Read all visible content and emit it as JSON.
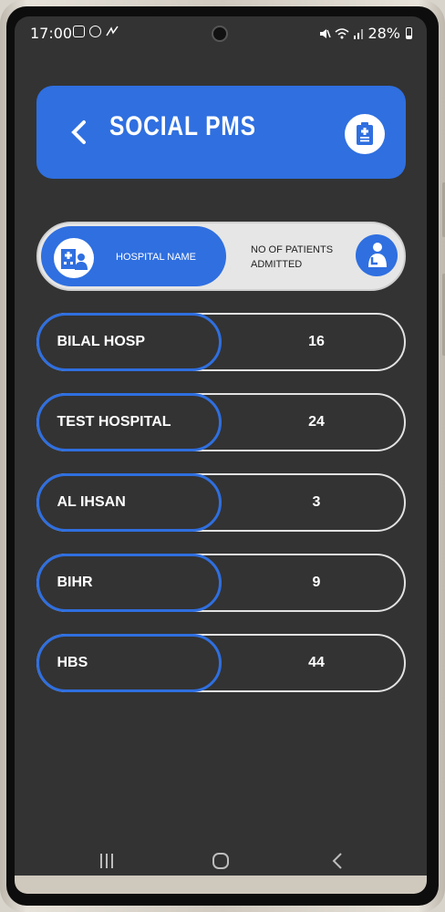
{
  "status_bar": {
    "time": "17:00",
    "battery": "28%"
  },
  "header": {
    "title": "SOCIAL PMS",
    "back_icon": "chevron-left-icon",
    "action_icon": "clipboard-medical-icon"
  },
  "table_header": {
    "hospital_label": "HOSPITAL NAME",
    "patients_label_line1": "NO OF PATIENTS",
    "patients_label_line2": "ADMITTED"
  },
  "rows": [
    {
      "name": "BILAL HOSP",
      "count": "16"
    },
    {
      "name": "TEST HOSPITAL",
      "count": "24"
    },
    {
      "name": "AL IHSAN",
      "count": "3"
    },
    {
      "name": "BIHR",
      "count": "9"
    },
    {
      "name": "HBS",
      "count": "44"
    }
  ],
  "nav": {
    "recent_icon": "recent-apps-icon",
    "home_icon": "home-icon",
    "back_icon": "back-icon"
  },
  "colors": {
    "accent": "#2f6fe0",
    "background": "#333333",
    "row_border": "#e2e2e2"
  }
}
